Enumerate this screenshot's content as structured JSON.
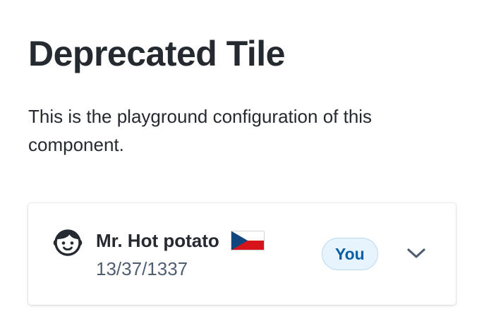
{
  "page": {
    "title": "Deprecated Tile",
    "description": "This is the playground configuration of this component."
  },
  "tile": {
    "icon": "passenger-face-icon",
    "title": "Mr. Hot potato",
    "flag": "czech-flag-icon",
    "subtitle": "13/37/1337",
    "badge": "You",
    "expand_icon": "chevron-down-icon"
  },
  "colors": {
    "text_primary": "#252a31",
    "text_secondary": "#4f5e71",
    "badge_background": "#e8f4fd",
    "badge_text": "#0b5fa5"
  }
}
